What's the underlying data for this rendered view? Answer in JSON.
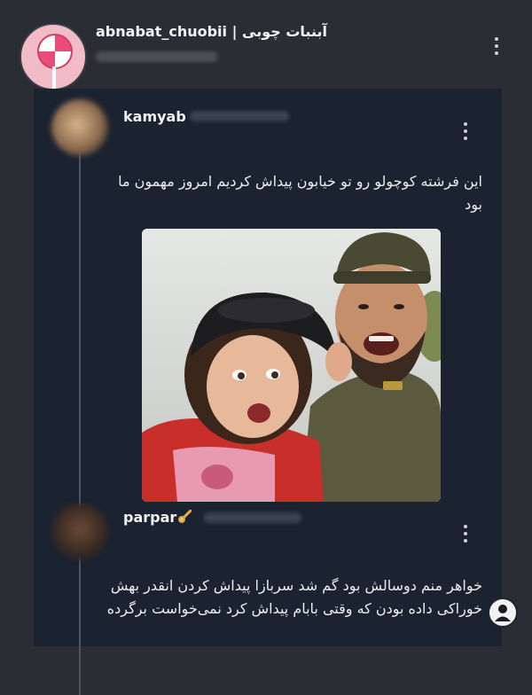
{
  "header": {
    "title": "abnabat_chuobii | آبنبات چوبی"
  },
  "posts": [
    {
      "username": "kamyab",
      "text": "این فرشته کوچولو رو تو خیابون پیداش کردیم امروز مهمون ما بود"
    },
    {
      "username": "parpar",
      "badge_icon": "comet-emoji-icon",
      "text": "خواهر منم دوسالش بود گم شد سربازا پیداش کردن انقدر بهش خوراکی داده بودن که وقتی بابام پیداش کرد نمی‌خواست برگرده"
    }
  ],
  "colors": {
    "background": "#2a2d33",
    "card": "#1b2330",
    "text": "#ececec"
  }
}
